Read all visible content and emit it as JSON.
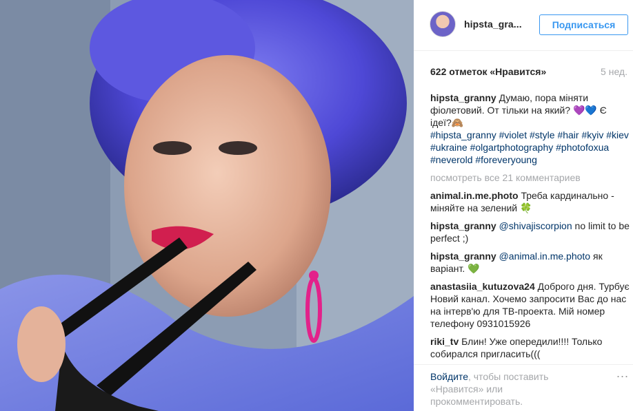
{
  "post": {
    "username": "hipsta_gra...",
    "follow_label": "Подписаться",
    "likes": "622 отметок «Нравится»",
    "age": "5 нед.",
    "caption": {
      "user": "hipsta_granny",
      "text": "Думаю, пора міняти фіолетовий. От тільки на який? 💜💙 Є ідеї?🙈",
      "hashtags": "#hipsta_granny #violet #style #hair #kyiv #kiev #ukraine #olgartphotography #photofoxua #neverold #foreveryoung"
    },
    "view_all": "посмотреть все 21 комментариев",
    "comments": [
      {
        "user": "animal.in.me.photo",
        "mention": "",
        "text": "Треба кардинально - міняйте на зелений 🍀"
      },
      {
        "user": "hipsta_granny",
        "mention": "@shivajiscorpion",
        "text": "no limit to be perfect ;)"
      },
      {
        "user": "hipsta_granny",
        "mention": "@animal.in.me.photo",
        "text": "як варіант. 💚"
      },
      {
        "user": "anastasiia_kutuzova24",
        "mention": "",
        "text": "Доброго дня. Турбує Новий канал. Хочемо запросити Вас до нас на інтерв'ю для ТВ-проекта. Мій номер телефону 0931015926"
      },
      {
        "user": "riki_tv",
        "mention": "",
        "text": "Блин! Уже опередили!!!! Только собирался пригласить((("
      }
    ],
    "footer": {
      "login_link": "Войдите",
      "login_text": ", чтобы поставить «Нравится» или прокомментировать.",
      "more": "..."
    }
  },
  "icons": {
    "avatar": "profile-avatar",
    "more": "more-options-icon"
  },
  "colors": {
    "accent": "#3897f0",
    "link": "#003569",
    "muted": "#a5a7aa",
    "text": "#262626"
  }
}
